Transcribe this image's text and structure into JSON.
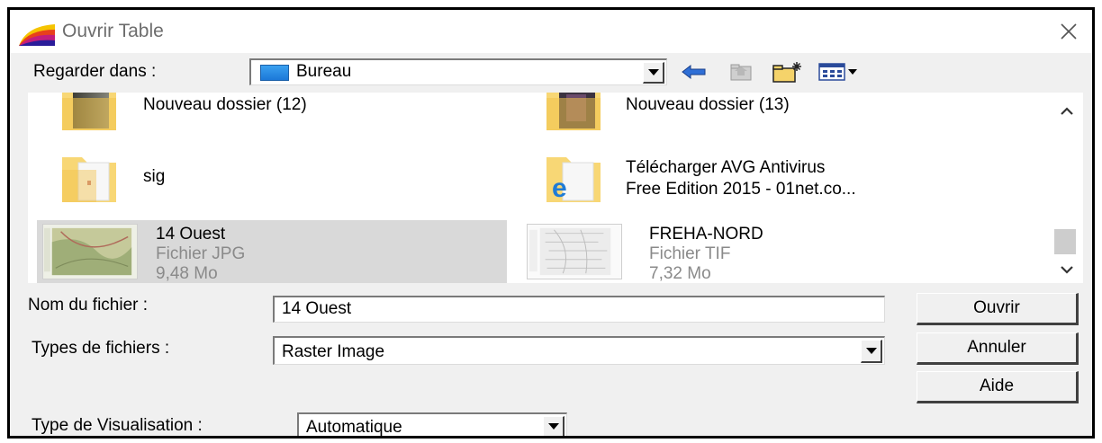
{
  "window": {
    "title": "Ouvrir Table",
    "app_icon": "mapinfo-logo-icon",
    "close_icon": "close-icon"
  },
  "look_in": {
    "label": "Regarder dans :",
    "value": "Bureau",
    "icon": "desktop-icon"
  },
  "toolbar": [
    {
      "name": "back-icon"
    },
    {
      "name": "up-folder-icon",
      "disabled": true
    },
    {
      "name": "new-folder-icon"
    },
    {
      "name": "view-menu-icon"
    }
  ],
  "files": [
    {
      "name": "Nouveau dossier (12)",
      "type": "",
      "size": "",
      "icon": "folder-icon"
    },
    {
      "name": "Nouveau dossier (13)",
      "type": "",
      "size": "",
      "icon": "folder-icon"
    },
    {
      "name": "sig",
      "type": "",
      "size": "",
      "icon": "folder-icon"
    },
    {
      "name_line1": "Télécharger AVG Antivirus",
      "name_line2": "Free Edition 2015 - 01net.co...",
      "icon": "folder-ie-icon"
    },
    {
      "name": "14 Ouest",
      "type": "Fichier JPG",
      "size": "9,48 Mo",
      "icon": "map-thumbnail",
      "selected": true
    },
    {
      "name": "FREHA-NORD",
      "type": "Fichier TIF",
      "size": "7,32 Mo",
      "icon": "map-thumbnail"
    }
  ],
  "file_name": {
    "label": "Nom du fichier :",
    "value": "14 Ouest"
  },
  "file_types": {
    "label": "Types de fichiers :",
    "value": "Raster Image"
  },
  "visualisation": {
    "label": "Type de Visualisation :",
    "value": "Automatique"
  },
  "buttons": {
    "open": "Ouvrir",
    "cancel": "Annuler",
    "help": "Aide"
  },
  "colors": {
    "selection": "#d9d9d9",
    "folder": "#f8d775",
    "dialog_bg": "#f0f0f0"
  }
}
